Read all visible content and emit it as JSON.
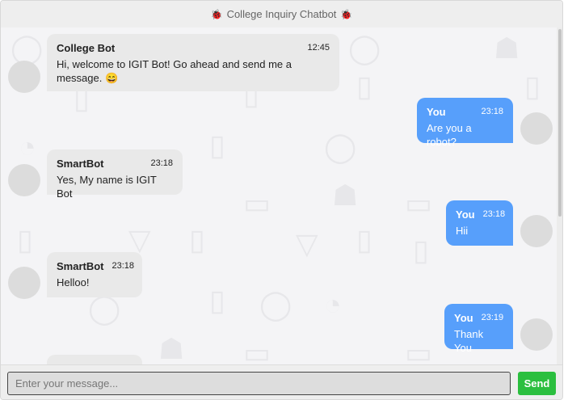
{
  "header": {
    "title": "College Inquiry Chatbot",
    "icon_left": "bug-icon",
    "icon_right": "bug-icon",
    "icon_glyph": "🐞"
  },
  "messages": [
    {
      "side": "left",
      "name": "College Bot",
      "time": "12:45",
      "text": "Hi, welcome to IGIT Bot! Go ahead and send me a message. 😄"
    },
    {
      "side": "right",
      "name": "You",
      "time": "23:18",
      "text": "Are you a robot?"
    },
    {
      "side": "left",
      "name": "SmartBot",
      "time": "23:18",
      "text": "Yes, My name is IGIT Bot"
    },
    {
      "side": "right",
      "name": "You",
      "time": "23:18",
      "text": "Hii"
    },
    {
      "side": "left",
      "name": "SmartBot",
      "time": "23:18",
      "text": "Helloo!"
    },
    {
      "side": "right",
      "name": "You",
      "time": "23:19",
      "text": "Thank You"
    }
  ],
  "composer": {
    "placeholder": "Enter your message...",
    "send_label": "Send"
  },
  "colors": {
    "user_bubble": "#579ffb",
    "bot_bubble": "#e9e9e9",
    "send_button": "#2bbf3f"
  }
}
